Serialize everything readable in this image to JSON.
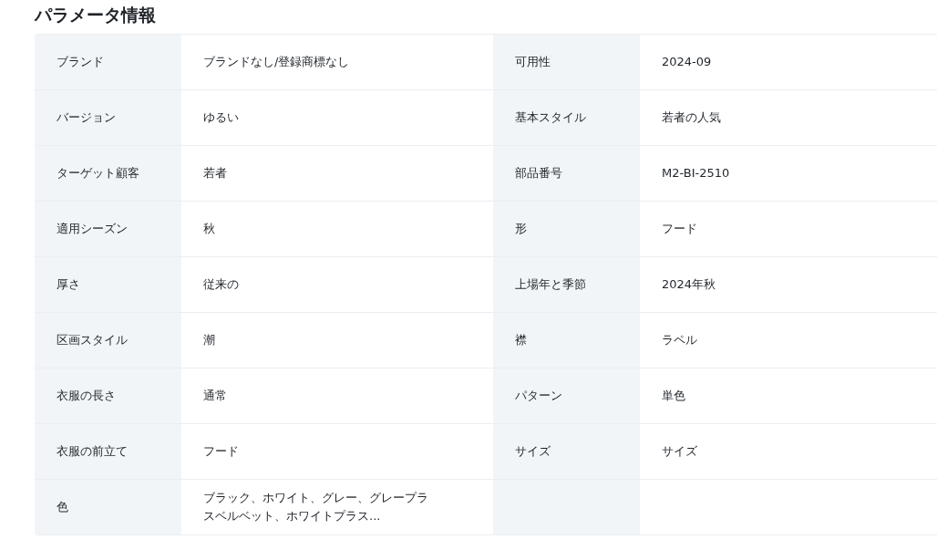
{
  "title": "パラメータ情報",
  "rows": [
    {
      "cells": [
        {
          "label": "ブランド",
          "value": "ブランドなし/登録商標なし"
        },
        {
          "label": "可用性",
          "value": "2024-09"
        }
      ]
    },
    {
      "cells": [
        {
          "label": "バージョン",
          "value": "ゆるい"
        },
        {
          "label": "基本スタイル",
          "value": "若者の人気"
        }
      ]
    },
    {
      "cells": [
        {
          "label": "ターゲット顧客",
          "value": "若者"
        },
        {
          "label": "部品番号",
          "value": "M2-BI-2510"
        }
      ]
    },
    {
      "cells": [
        {
          "label": "適用シーズン",
          "value": "秋"
        },
        {
          "label": "形",
          "value": "フード"
        }
      ]
    },
    {
      "cells": [
        {
          "label": "厚さ",
          "value": "従来の"
        },
        {
          "label": "上場年と季節",
          "value": "2024年秋"
        }
      ]
    },
    {
      "cells": [
        {
          "label": "区画スタイル",
          "value": "潮"
        },
        {
          "label": "襟",
          "value": "ラペル"
        }
      ]
    },
    {
      "cells": [
        {
          "label": "衣服の長さ",
          "value": "通常"
        },
        {
          "label": "パターン",
          "value": "単色"
        }
      ]
    },
    {
      "cells": [
        {
          "label": "衣服の前立て",
          "value": "フード"
        },
        {
          "label": "サイズ",
          "value": "サイズ"
        }
      ]
    },
    {
      "cells": [
        {
          "label": "色",
          "value": "ブラック、ホワイト、グレー、グレープラスベルベット、ホワイトプラス..."
        }
      ]
    }
  ]
}
